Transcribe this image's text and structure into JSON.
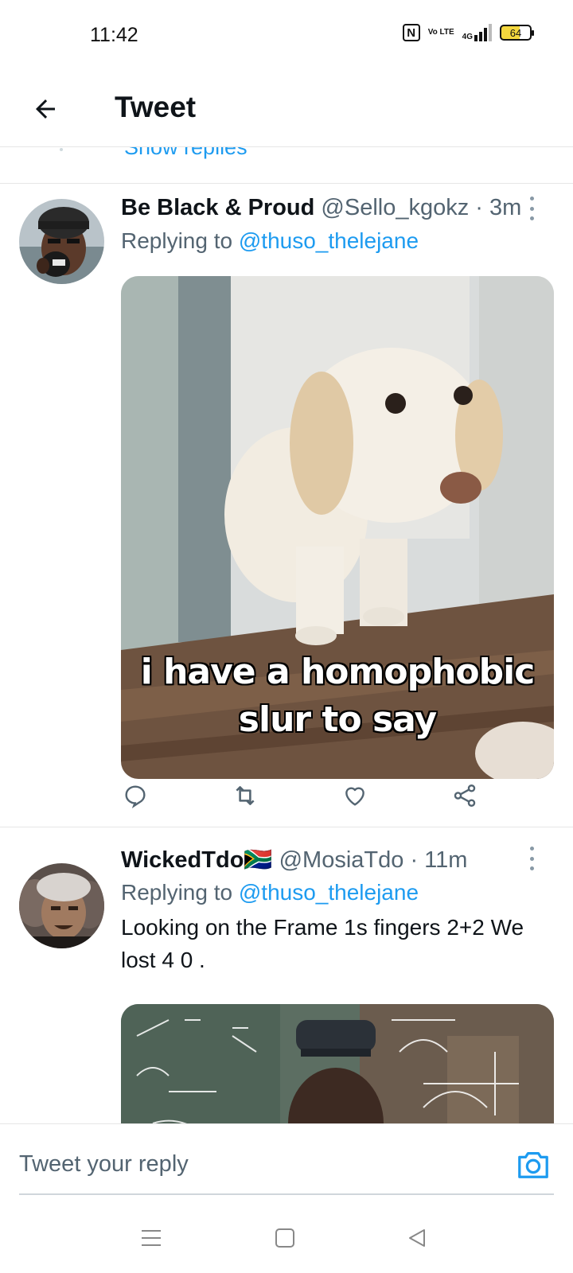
{
  "status_bar": {
    "time": "11:42",
    "network": "4G",
    "volte": "Vo LTE",
    "battery": "64"
  },
  "header": {
    "title": "Tweet"
  },
  "thread_above": {
    "show_replies_label": "Show replies"
  },
  "tweets": [
    {
      "name": "Be Black & Proud",
      "handle": "@Sello_kgokz",
      "time": "· 3m",
      "replying_prefix": "Replying to",
      "replying_to": "@thuso_thelejane",
      "text": "",
      "image_caption": "i have a homophobic slur to say"
    },
    {
      "name": "WickedTdo",
      "flag": "🇿🇦",
      "handle": "@MosiaTdo",
      "time": "· 11m",
      "replying_prefix": "Replying to",
      "replying_to": "@thuso_thelejane",
      "text": "Looking on the Frame 1s fingers 2+2 We lost 4 0 ."
    }
  ],
  "reply_box": {
    "placeholder": "Tweet your reply"
  },
  "colors": {
    "accent": "#1d9bf0",
    "secondary_text": "#536471",
    "text": "#0f1419"
  },
  "icons": [
    "back-arrow-icon",
    "more-options-icon",
    "reply-icon",
    "retweet-icon",
    "like-icon",
    "share-icon",
    "camera-icon",
    "menu-icon",
    "home-square-icon",
    "back-triangle-icon"
  ]
}
